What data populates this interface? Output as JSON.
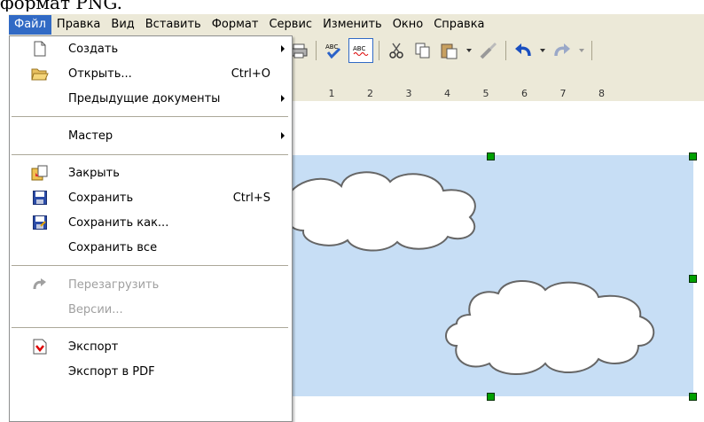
{
  "caption": "формат PNG.",
  "menubar": {
    "items": [
      "Файл",
      "Правка",
      "Вид",
      "Вставить",
      "Формат",
      "Сервис",
      "Изменить",
      "Окно",
      "Справка"
    ]
  },
  "ruler": {
    "ticks": [
      "1",
      "2",
      "3",
      "4",
      "5",
      "6",
      "7",
      "8"
    ]
  },
  "file_menu": {
    "new": "Создать",
    "open": "Открыть...",
    "open_shortcut": "Ctrl+O",
    "recent": "Предыдущие документы",
    "wizard": "Мастер",
    "close": "Закрыть",
    "save": "Сохранить",
    "save_shortcut": "Ctrl+S",
    "save_as": "Сохранить как...",
    "save_all": "Сохранить все",
    "reload": "Перезагрузить",
    "versions": "Версии...",
    "export": "Экспорт",
    "export_pdf": "Экспорт в PDF"
  },
  "colors": {
    "menu_highlight": "#316ac5",
    "sky": "#c7def5",
    "handle": "#00a000"
  }
}
